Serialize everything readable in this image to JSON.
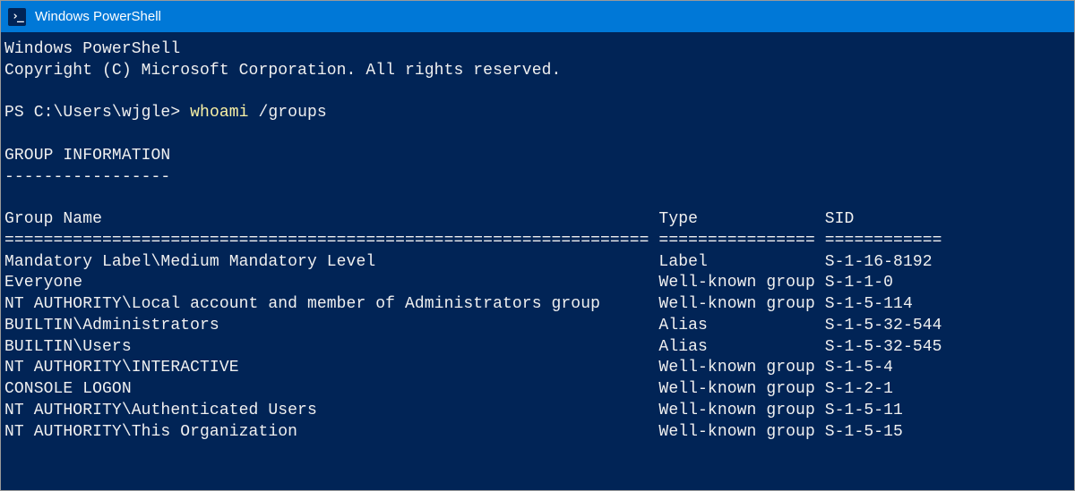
{
  "window": {
    "title": "Windows PowerShell",
    "icon": "powershell-icon"
  },
  "banner": {
    "line1": "Windows PowerShell",
    "line2": "Copyright (C) Microsoft Corporation. All rights reserved."
  },
  "prompt": {
    "text": "PS C:\\Users\\wjgle> ",
    "command_part1": "whoami",
    "command_part2": " /groups"
  },
  "section": {
    "header": "GROUP INFORMATION",
    "divider": "-----------------"
  },
  "table": {
    "headers": {
      "group_name": "Group Name",
      "type": "Type",
      "sid": "SID"
    },
    "rules": {
      "col1": "==================================================================",
      "col2": "================",
      "col3": "============"
    },
    "rows": [
      {
        "group_name": "Mandatory Label\\Medium Mandatory Level",
        "type": "Label",
        "sid": "S-1-16-8192"
      },
      {
        "group_name": "Everyone",
        "type": "Well-known group",
        "sid": "S-1-1-0"
      },
      {
        "group_name": "NT AUTHORITY\\Local account and member of Administrators group",
        "type": "Well-known group",
        "sid": "S-1-5-114"
      },
      {
        "group_name": "BUILTIN\\Administrators",
        "type": "Alias",
        "sid": "S-1-5-32-544"
      },
      {
        "group_name": "BUILTIN\\Users",
        "type": "Alias",
        "sid": "S-1-5-32-545"
      },
      {
        "group_name": "NT AUTHORITY\\INTERACTIVE",
        "type": "Well-known group",
        "sid": "S-1-5-4"
      },
      {
        "group_name": "CONSOLE LOGON",
        "type": "Well-known group",
        "sid": "S-1-2-1"
      },
      {
        "group_name": "NT AUTHORITY\\Authenticated Users",
        "type": "Well-known group",
        "sid": "S-1-5-11"
      },
      {
        "group_name": "NT AUTHORITY\\This Organization",
        "type": "Well-known group",
        "sid": "S-1-5-15"
      }
    ]
  },
  "col_widths": {
    "c1": 67,
    "c2": 17
  }
}
